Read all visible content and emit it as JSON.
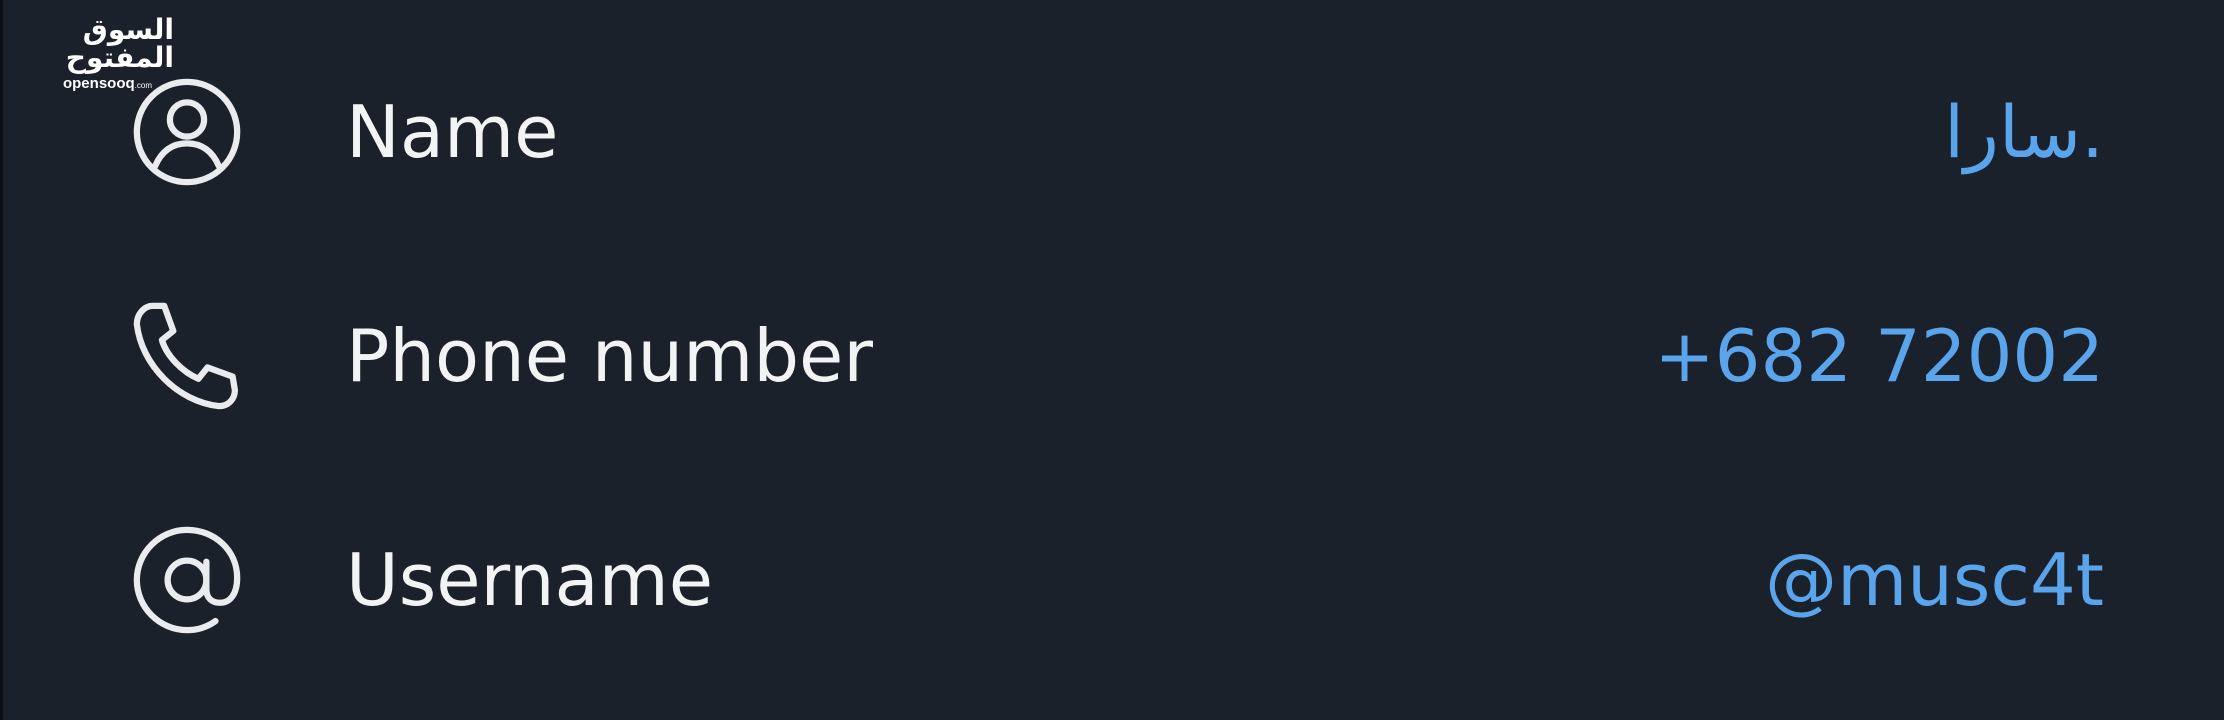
{
  "watermark": {
    "arabic": "السوق المفتوح",
    "latin": "opensooq",
    "latin_small": ".com"
  },
  "rows": [
    {
      "icon": "user-circle-icon",
      "label": "Name",
      "value": "سارا."
    },
    {
      "icon": "phone-icon",
      "label": "Phone number",
      "value": "+682 72002"
    },
    {
      "icon": "at-sign-icon",
      "label": "Username",
      "value": "@musc4t"
    }
  ],
  "colors": {
    "background": "#1a212b",
    "label": "#f2f3f5",
    "value_accent": "#5aa4ec",
    "icon": "#e9ebee"
  }
}
